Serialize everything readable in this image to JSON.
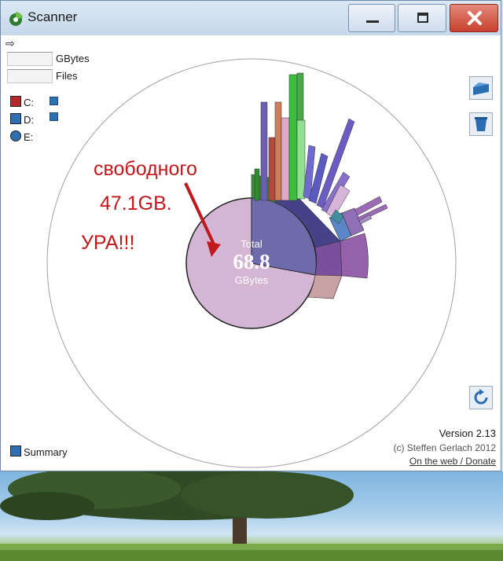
{
  "window": {
    "title": "Scanner"
  },
  "fields": {
    "size_unit": "GBytes",
    "files_label": "Files"
  },
  "drives": [
    {
      "label": "C:",
      "color": "#b3272d"
    },
    {
      "label": "D:",
      "color": "#2d6fb0"
    },
    {
      "label": "E:",
      "color": "#2d6fb0"
    }
  ],
  "center": {
    "top": "Total",
    "value": "68.8",
    "unit": "GBytes"
  },
  "annotation": {
    "line1": "свободного",
    "line2": "47.1GB.",
    "line3": "УРА!!!"
  },
  "summary_label": "Summary",
  "footer": {
    "version": "Version 2.13",
    "copyright": "(c) Steffen Gerlach 2012",
    "link": "On the web / Donate"
  },
  "colors": {
    "free_space": "#d4b5d4",
    "used_dark": "#4d4a8c",
    "used_purple": "#8a55a0",
    "accent": "#c0181b"
  }
}
